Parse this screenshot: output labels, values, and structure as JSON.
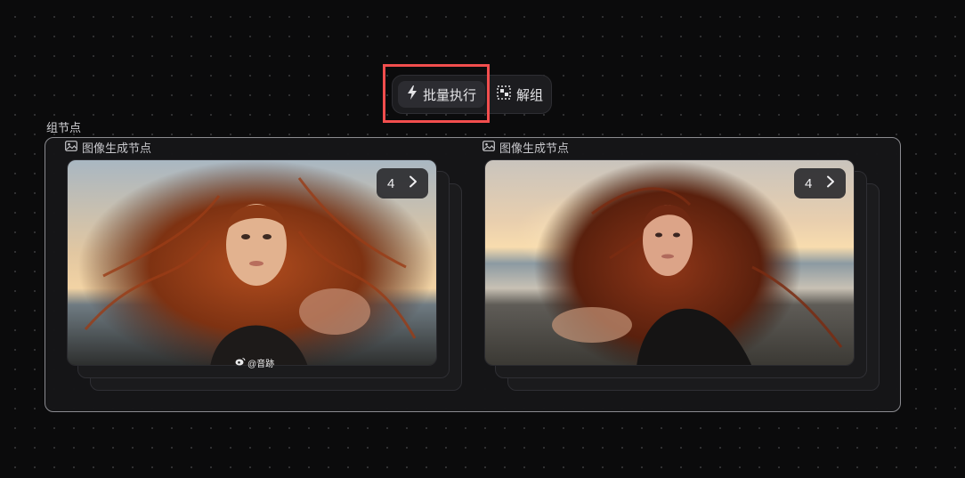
{
  "toolbar": {
    "batch_label": "批量执行",
    "ungroup_label": "解组"
  },
  "group": {
    "label": "组节点",
    "nodes": [
      {
        "title": "图像生成节点",
        "count": "4"
      },
      {
        "title": "图像生成节点",
        "count": "4"
      }
    ]
  },
  "watermark": "@音跡",
  "colors": {
    "highlight": "#f24e4e",
    "frame_border": "#8b8b90",
    "background": "#0b0b0c"
  },
  "icons": {
    "batch": "lightning-icon",
    "ungroup": "ungroup-icon",
    "node": "image-icon",
    "next": "chevron-right-icon",
    "weibo": "weibo-icon"
  }
}
